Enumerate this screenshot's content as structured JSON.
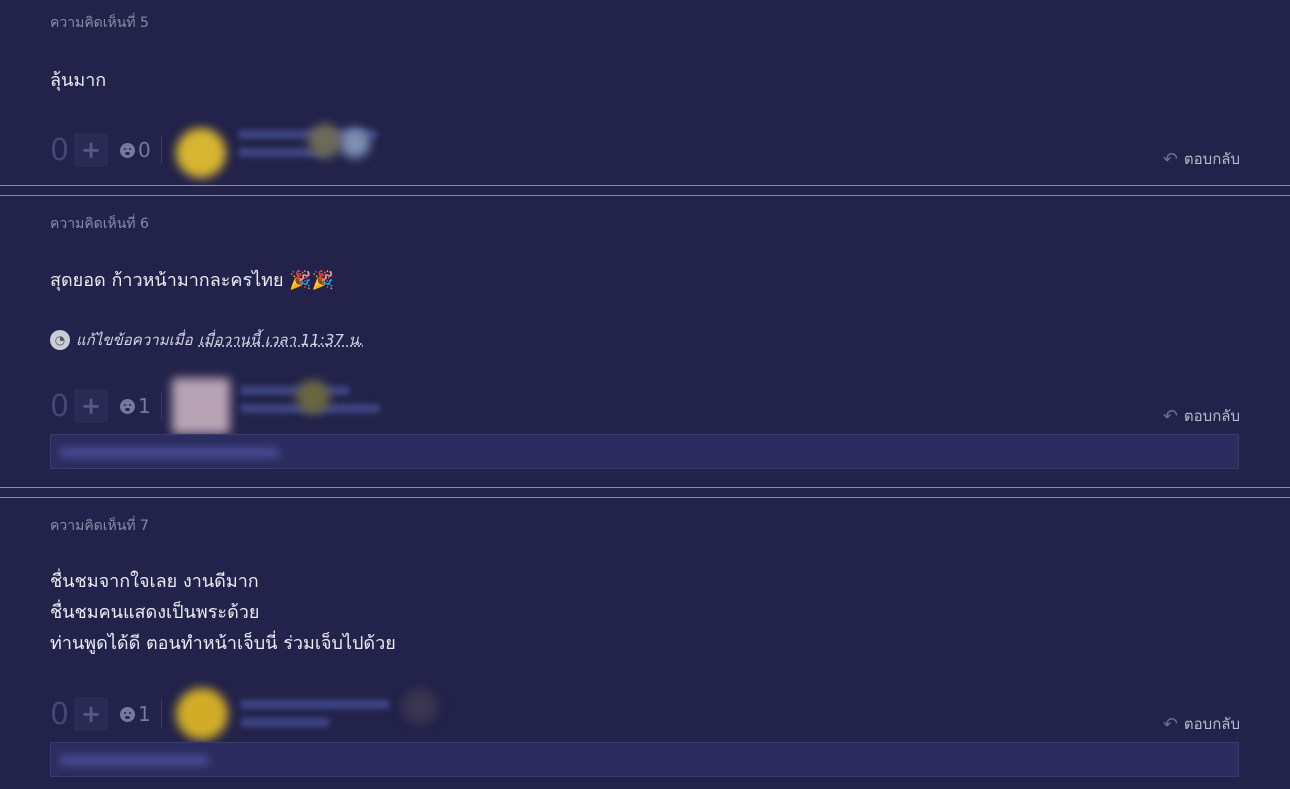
{
  "comments": [
    {
      "number_label": "ความคิดเห็นที่ 5",
      "body": [
        "ลุ้นมาก"
      ],
      "vote_count": "0",
      "emotion_count": "0",
      "reply_label": "ตอบกลับ"
    },
    {
      "number_label": "ความคิดเห็นที่ 6",
      "body": [
        "สุดยอด ก้าวหน้ามากละครไทย 🎉🎉"
      ],
      "edit_prefix": "แก้ไขข้อความเมื่อ",
      "edit_time": "เมื่อวานนี้ เวลา 11:37 น.",
      "vote_count": "0",
      "emotion_count": "1",
      "reply_label": "ตอบกลับ"
    },
    {
      "number_label": "ความคิดเห็นที่ 7",
      "body": [
        "ชื่นชมจากใจเลย งานดีมาก",
        "ชื่นชมคนแสดงเป็นพระด้วย",
        "ท่านพูดได้ดี ตอนทำหน้าเจ็บนี่ ร่วมเจ็บไปด้วย"
      ],
      "vote_count": "0",
      "emotion_count": "1",
      "reply_label": "ตอบกลับ"
    }
  ],
  "icons": {
    "plus": "plus-icon",
    "emotion": "emotion-icon",
    "reply": "reply-icon",
    "clock": "clock-icon"
  },
  "colors": {
    "background": "#22224a",
    "reply_box": "#2c2c60",
    "muted_text": "#8a8ca6"
  }
}
